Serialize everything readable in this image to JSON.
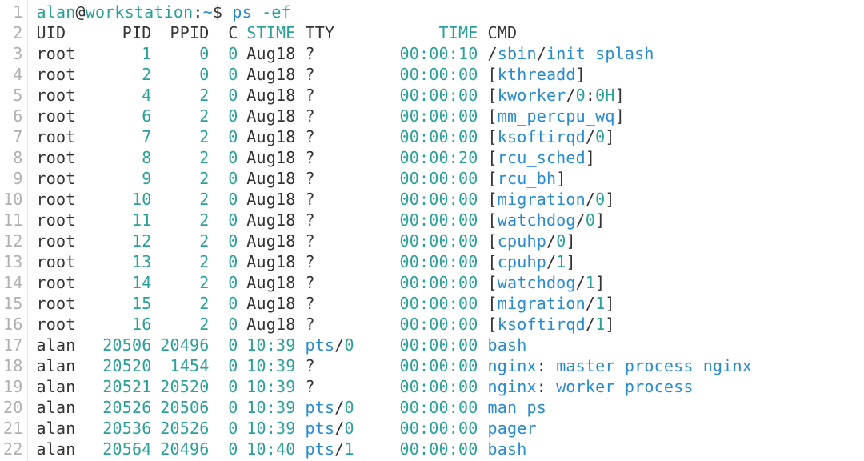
{
  "prompt": {
    "user": "alan",
    "host": "workstation",
    "sep1": "@",
    "sep2": ":",
    "path": "~",
    "dollar": "$",
    "command": "ps",
    "args": "-ef"
  },
  "header": {
    "uid": "UID",
    "pid": "PID",
    "ppid": "PPID",
    "c": "C",
    "stime": "STIME",
    "tty": "TTY",
    "time": "TIME",
    "cmd": "CMD"
  },
  "rows": [
    {
      "uid": "root",
      "pid": "1",
      "ppid": "0",
      "c": "0",
      "stime": "Aug18",
      "tty": "?",
      "time": "00:00:10",
      "cmd_parts": [
        {
          "t": "/",
          "c": "black"
        },
        {
          "t": "sbin",
          "c": "blue"
        },
        {
          "t": "/",
          "c": "black"
        },
        {
          "t": "init splash",
          "c": "blue"
        }
      ]
    },
    {
      "uid": "root",
      "pid": "2",
      "ppid": "0",
      "c": "0",
      "stime": "Aug18",
      "tty": "?",
      "time": "00:00:00",
      "cmd_parts": [
        {
          "t": "[",
          "c": "black"
        },
        {
          "t": "kthreadd",
          "c": "blue"
        },
        {
          "t": "]",
          "c": "black"
        }
      ]
    },
    {
      "uid": "root",
      "pid": "4",
      "ppid": "2",
      "c": "0",
      "stime": "Aug18",
      "tty": "?",
      "time": "00:00:00",
      "cmd_parts": [
        {
          "t": "[",
          "c": "black"
        },
        {
          "t": "kworker",
          "c": "blue"
        },
        {
          "t": "/",
          "c": "black"
        },
        {
          "t": "0",
          "c": "teal"
        },
        {
          "t": ":",
          "c": "black"
        },
        {
          "t": "0H",
          "c": "teal"
        },
        {
          "t": "]",
          "c": "black"
        }
      ]
    },
    {
      "uid": "root",
      "pid": "6",
      "ppid": "2",
      "c": "0",
      "stime": "Aug18",
      "tty": "?",
      "time": "00:00:00",
      "cmd_parts": [
        {
          "t": "[",
          "c": "black"
        },
        {
          "t": "mm_percpu_wq",
          "c": "blue"
        },
        {
          "t": "]",
          "c": "black"
        }
      ]
    },
    {
      "uid": "root",
      "pid": "7",
      "ppid": "2",
      "c": "0",
      "stime": "Aug18",
      "tty": "?",
      "time": "00:00:00",
      "cmd_parts": [
        {
          "t": "[",
          "c": "black"
        },
        {
          "t": "ksoftirqd",
          "c": "blue"
        },
        {
          "t": "/",
          "c": "black"
        },
        {
          "t": "0",
          "c": "teal"
        },
        {
          "t": "]",
          "c": "black"
        }
      ]
    },
    {
      "uid": "root",
      "pid": "8",
      "ppid": "2",
      "c": "0",
      "stime": "Aug18",
      "tty": "?",
      "time": "00:00:20",
      "cmd_parts": [
        {
          "t": "[",
          "c": "black"
        },
        {
          "t": "rcu_sched",
          "c": "blue"
        },
        {
          "t": "]",
          "c": "black"
        }
      ]
    },
    {
      "uid": "root",
      "pid": "9",
      "ppid": "2",
      "c": "0",
      "stime": "Aug18",
      "tty": "?",
      "time": "00:00:00",
      "cmd_parts": [
        {
          "t": "[",
          "c": "black"
        },
        {
          "t": "rcu_bh",
          "c": "blue"
        },
        {
          "t": "]",
          "c": "black"
        }
      ]
    },
    {
      "uid": "root",
      "pid": "10",
      "ppid": "2",
      "c": "0",
      "stime": "Aug18",
      "tty": "?",
      "time": "00:00:00",
      "cmd_parts": [
        {
          "t": "[",
          "c": "black"
        },
        {
          "t": "migration",
          "c": "blue"
        },
        {
          "t": "/",
          "c": "black"
        },
        {
          "t": "0",
          "c": "teal"
        },
        {
          "t": "]",
          "c": "black"
        }
      ]
    },
    {
      "uid": "root",
      "pid": "11",
      "ppid": "2",
      "c": "0",
      "stime": "Aug18",
      "tty": "?",
      "time": "00:00:00",
      "cmd_parts": [
        {
          "t": "[",
          "c": "black"
        },
        {
          "t": "watchdog",
          "c": "blue"
        },
        {
          "t": "/",
          "c": "black"
        },
        {
          "t": "0",
          "c": "teal"
        },
        {
          "t": "]",
          "c": "black"
        }
      ]
    },
    {
      "uid": "root",
      "pid": "12",
      "ppid": "2",
      "c": "0",
      "stime": "Aug18",
      "tty": "?",
      "time": "00:00:00",
      "cmd_parts": [
        {
          "t": "[",
          "c": "black"
        },
        {
          "t": "cpuhp",
          "c": "blue"
        },
        {
          "t": "/",
          "c": "black"
        },
        {
          "t": "0",
          "c": "teal"
        },
        {
          "t": "]",
          "c": "black"
        }
      ]
    },
    {
      "uid": "root",
      "pid": "13",
      "ppid": "2",
      "c": "0",
      "stime": "Aug18",
      "tty": "?",
      "time": "00:00:00",
      "cmd_parts": [
        {
          "t": "[",
          "c": "black"
        },
        {
          "t": "cpuhp",
          "c": "blue"
        },
        {
          "t": "/",
          "c": "black"
        },
        {
          "t": "1",
          "c": "teal"
        },
        {
          "t": "]",
          "c": "black"
        }
      ]
    },
    {
      "uid": "root",
      "pid": "14",
      "ppid": "2",
      "c": "0",
      "stime": "Aug18",
      "tty": "?",
      "time": "00:00:00",
      "cmd_parts": [
        {
          "t": "[",
          "c": "black"
        },
        {
          "t": "watchdog",
          "c": "blue"
        },
        {
          "t": "/",
          "c": "black"
        },
        {
          "t": "1",
          "c": "teal"
        },
        {
          "t": "]",
          "c": "black"
        }
      ]
    },
    {
      "uid": "root",
      "pid": "15",
      "ppid": "2",
      "c": "0",
      "stime": "Aug18",
      "tty": "?",
      "time": "00:00:00",
      "cmd_parts": [
        {
          "t": "[",
          "c": "black"
        },
        {
          "t": "migration",
          "c": "blue"
        },
        {
          "t": "/",
          "c": "black"
        },
        {
          "t": "1",
          "c": "teal"
        },
        {
          "t": "]",
          "c": "black"
        }
      ]
    },
    {
      "uid": "root",
      "pid": "16",
      "ppid": "2",
      "c": "0",
      "stime": "Aug18",
      "tty": "?",
      "time": "00:00:00",
      "cmd_parts": [
        {
          "t": "[",
          "c": "black"
        },
        {
          "t": "ksoftirqd",
          "c": "blue"
        },
        {
          "t": "/",
          "c": "black"
        },
        {
          "t": "1",
          "c": "teal"
        },
        {
          "t": "]",
          "c": "black"
        }
      ]
    },
    {
      "uid": "alan",
      "pid": "20506",
      "ppid": "20496",
      "c": "0",
      "stime": "10:39",
      "tty": "pts/0",
      "time": "00:00:00",
      "cmd_parts": [
        {
          "t": "bash",
          "c": "blue"
        }
      ]
    },
    {
      "uid": "alan",
      "pid": "20520",
      "ppid": "1454",
      "c": "0",
      "stime": "10:39",
      "tty": "?",
      "time": "00:00:00",
      "cmd_parts": [
        {
          "t": "nginx",
          "c": "blue"
        },
        {
          "t": ": ",
          "c": "black"
        },
        {
          "t": "master process nginx",
          "c": "blue"
        }
      ]
    },
    {
      "uid": "alan",
      "pid": "20521",
      "ppid": "20520",
      "c": "0",
      "stime": "10:39",
      "tty": "?",
      "time": "00:00:00",
      "cmd_parts": [
        {
          "t": "nginx",
          "c": "blue"
        },
        {
          "t": ": ",
          "c": "black"
        },
        {
          "t": "worker process",
          "c": "blue"
        }
      ]
    },
    {
      "uid": "alan",
      "pid": "20526",
      "ppid": "20506",
      "c": "0",
      "stime": "10:39",
      "tty": "pts/0",
      "time": "00:00:00",
      "cmd_parts": [
        {
          "t": "man ps",
          "c": "blue"
        }
      ]
    },
    {
      "uid": "alan",
      "pid": "20536",
      "ppid": "20526",
      "c": "0",
      "stime": "10:39",
      "tty": "pts/0",
      "time": "00:00:00",
      "cmd_parts": [
        {
          "t": "pager",
          "c": "blue"
        }
      ]
    },
    {
      "uid": "alan",
      "pid": "20564",
      "ppid": "20496",
      "c": "0",
      "stime": "10:40",
      "tty": "pts/1",
      "time": "00:00:00",
      "cmd_parts": [
        {
          "t": "bash",
          "c": "blue"
        }
      ]
    }
  ],
  "line_count": 22
}
